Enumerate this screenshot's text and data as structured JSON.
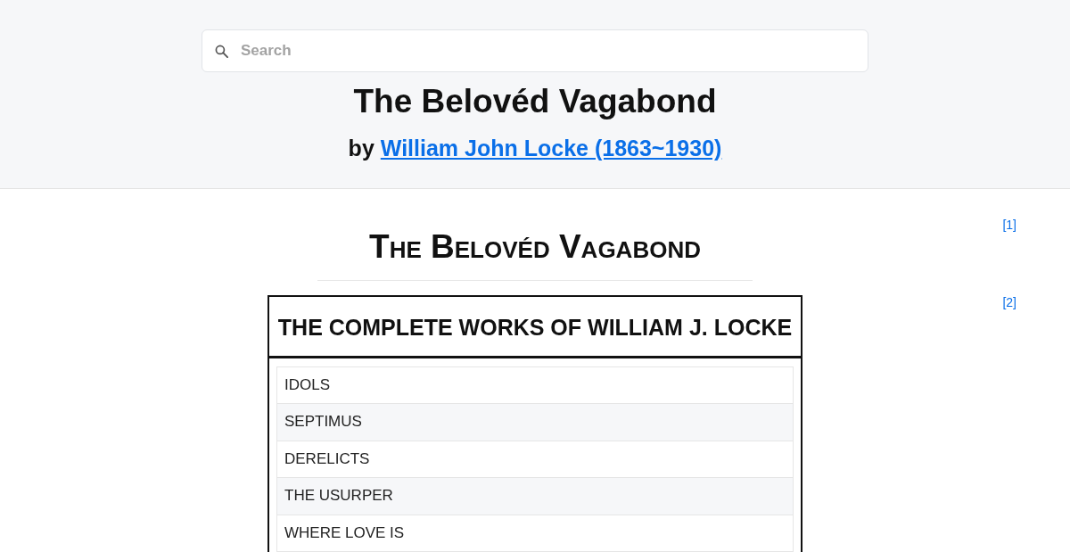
{
  "search": {
    "placeholder": "Search"
  },
  "header": {
    "title": "The Belovéd Vagabond",
    "byline_prefix": "by",
    "author_link": "William John Locke (1863~1930)"
  },
  "book": {
    "title": "The Belovéd Vagabond",
    "footnote": "[1]"
  },
  "works_table": {
    "heading": "THE COMPLETE WORKS OF WILLIAM J. LOCKE",
    "footnote": "[2]",
    "items": [
      "IDOLS",
      "SEPTIMUS",
      "DERELICTS",
      "THE USURPER",
      "WHERE LOVE IS"
    ]
  }
}
